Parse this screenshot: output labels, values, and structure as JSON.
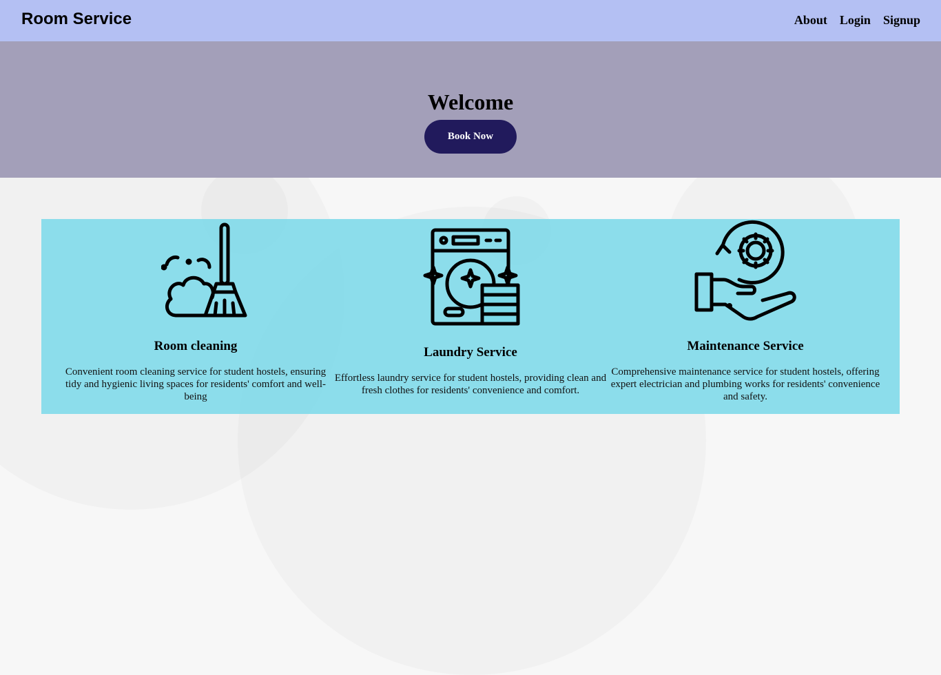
{
  "navbar": {
    "brand": "Room Service",
    "links": [
      "About",
      "Login",
      "Signup"
    ]
  },
  "hero": {
    "title": "Welcome",
    "cta_label": "Book Now"
  },
  "services": [
    {
      "icon": "broom-cleaning-icon",
      "title": "Room cleaning",
      "description": "Convenient room cleaning service for student hostels, ensuring tidy and hygienic living spaces for residents' comfort and well-being"
    },
    {
      "icon": "washing-machine-icon",
      "title": "Laundry Service",
      "description": "Effortless laundry service for student hostels, providing clean and fresh clothes for residents' convenience and comfort."
    },
    {
      "icon": "hand-gear-maintenance-icon",
      "title": "Maintenance Service",
      "description": "Comprehensive maintenance service for student hostels, offering expert electrician and plumbing works for residents' convenience and safety."
    }
  ],
  "colors": {
    "navbar_bg": "#b4c0f3",
    "hero_bg": "#a39fb9",
    "button_bg": "#211a5c",
    "services_bg": "#7ddae9"
  }
}
